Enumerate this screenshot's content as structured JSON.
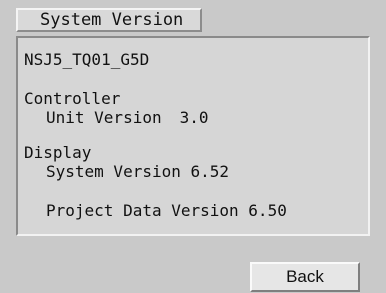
{
  "title_tab": "System Version",
  "model": "NSJ5_TQ01_G5D",
  "controller": {
    "heading": "Controller",
    "unit_version_label": "Unit Version",
    "unit_version_value": "3.0"
  },
  "display": {
    "heading": "Display",
    "system_version_label": "System Version",
    "system_version_value": "6.52",
    "project_version_label": "Project Data Version",
    "project_version_value": "6.50"
  },
  "back_label": "Back"
}
